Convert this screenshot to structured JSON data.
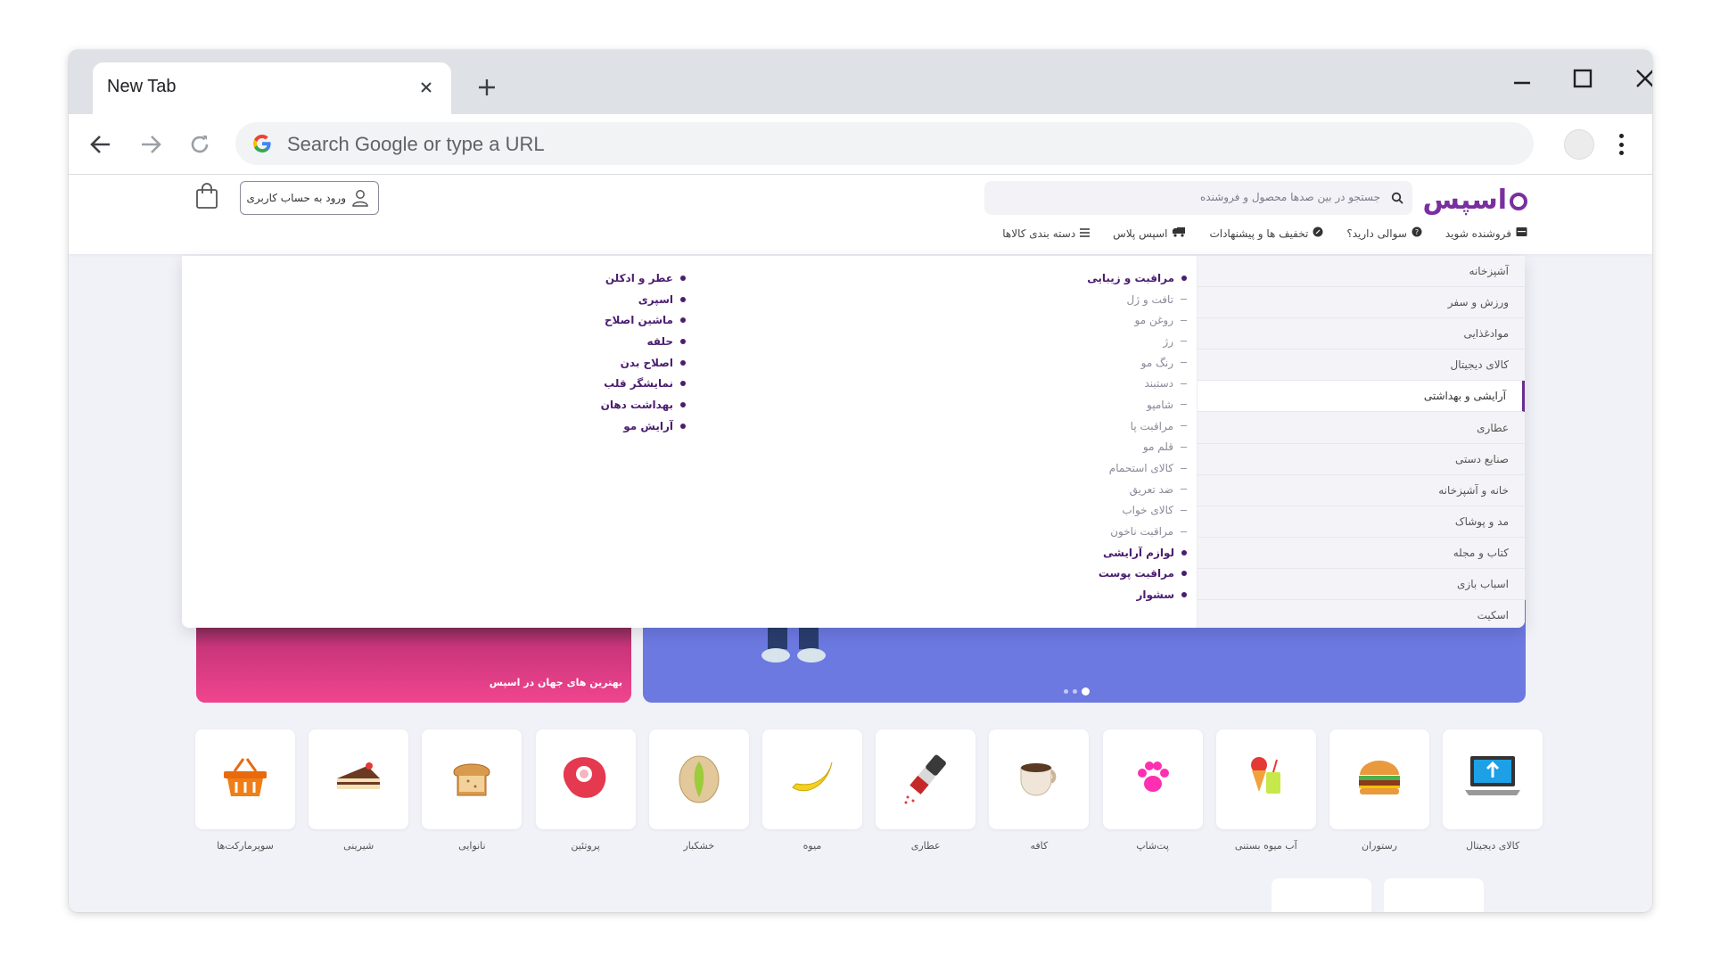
{
  "browser": {
    "tab_title": "New Tab",
    "omnibox_placeholder": "Search Google or type a URL"
  },
  "site": {
    "logo_text": "اسپس",
    "search_placeholder": "جستجو در بین صدها محصول و فروشنده",
    "login_label": "ورود به حساب کاربری",
    "nav": [
      {
        "label": "دسته بندی کالاها",
        "icon": "menu-icon"
      },
      {
        "label": "اسپس پلاس",
        "icon": "truck-icon"
      },
      {
        "label": "تخفیف ها و پیشنهادات",
        "icon": "discount-icon"
      },
      {
        "label": "سوالی دارید؟",
        "icon": "question-icon"
      },
      {
        "label": "فروشنده شوید",
        "icon": "store-icon"
      }
    ]
  },
  "mega_menu": {
    "categories": [
      "آشپزخانه",
      "ورزش و سفر",
      "موادغذایی",
      "کالای دیجیتال",
      "آرایشی و بهداشتی",
      "عطاری",
      "صنایع دستی",
      "خانه و آشپزخانه",
      "مد و پوشاک",
      "کتاب و مجله",
      "اسباب بازی",
      "اسکیت"
    ],
    "active_category": "آرایشی و بهداشتی",
    "column_1": [
      {
        "label": "مراقبت و زیبایی",
        "type": "main"
      },
      {
        "label": "تافت و ژل",
        "type": "sub"
      },
      {
        "label": "روغن مو",
        "type": "sub"
      },
      {
        "label": "رژ",
        "type": "sub"
      },
      {
        "label": "رنگ مو",
        "type": "sub"
      },
      {
        "label": "دستبند",
        "type": "sub"
      },
      {
        "label": "شامپو",
        "type": "sub"
      },
      {
        "label": "مراقبت پا",
        "type": "sub"
      },
      {
        "label": "قلم مو",
        "type": "sub"
      },
      {
        "label": "کالای استحمام",
        "type": "sub"
      },
      {
        "label": "ضد تعریق",
        "type": "sub"
      },
      {
        "label": "کالای خواب",
        "type": "sub"
      },
      {
        "label": "مراقبت ناخون",
        "type": "sub"
      },
      {
        "label": "لوازم آرایشی",
        "type": "main"
      },
      {
        "label": "مراقبت پوست",
        "type": "main"
      },
      {
        "label": "سشوار",
        "type": "main"
      }
    ],
    "column_2": [
      {
        "label": "عطر و ادکلن",
        "type": "main"
      },
      {
        "label": "اسپری",
        "type": "main"
      },
      {
        "label": "ماشین اصلاح",
        "type": "main"
      },
      {
        "label": "حلقه",
        "type": "main"
      },
      {
        "label": "اصلاح بدن",
        "type": "main"
      },
      {
        "label": "نمایشگر قلب",
        "type": "main"
      },
      {
        "label": "بهداشت دهان",
        "type": "main"
      },
      {
        "label": "آرایش مو",
        "type": "main"
      }
    ]
  },
  "banners": {
    "left_caption": "بهترین های جهان در اسپس"
  },
  "quick_categories": [
    {
      "label": "کالای دیجیتال",
      "icon": "laptop-icon"
    },
    {
      "label": "رستوران",
      "icon": "burger-icon"
    },
    {
      "label": "آب میوه بستنی",
      "icon": "icecream-juice-icon"
    },
    {
      "label": "پت‌شاپ",
      "icon": "paw-icon"
    },
    {
      "label": "کافه",
      "icon": "coffee-cup-icon"
    },
    {
      "label": "عطاری",
      "icon": "spice-grinder-icon"
    },
    {
      "label": "میوه",
      "icon": "banana-icon"
    },
    {
      "label": "خشکبار",
      "icon": "pistachio-icon"
    },
    {
      "label": "پروتئین",
      "icon": "meat-icon"
    },
    {
      "label": "نانوایی",
      "icon": "bread-icon"
    },
    {
      "label": "شیرینی",
      "icon": "cake-icon"
    },
    {
      "label": "سوپرمارکت‌ها",
      "icon": "basket-icon"
    }
  ],
  "colors": {
    "brand": "#7a2fa0",
    "menu_text": "#4b1d6f",
    "page_bg": "#f1f1f8",
    "banner_right": "#6c79e0",
    "banner_left": "#f0458f"
  }
}
